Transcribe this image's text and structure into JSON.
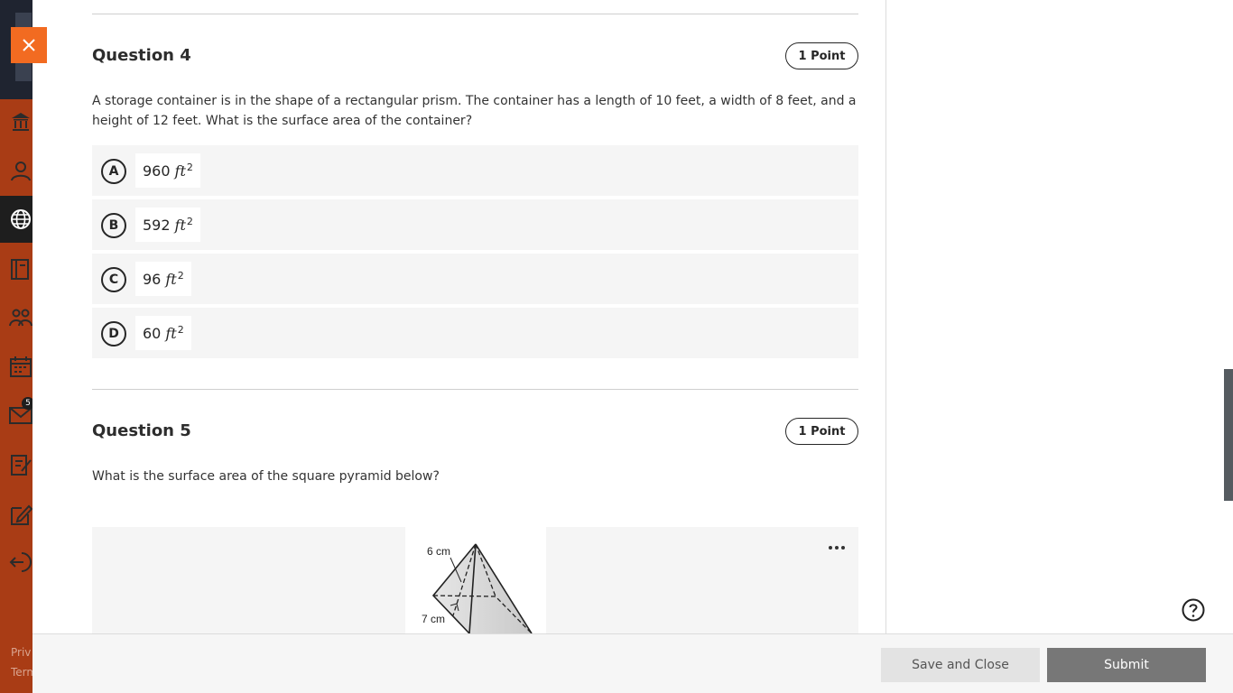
{
  "close_label": "×",
  "nav": {
    "badge_count": "5",
    "footer_links": [
      "Priv",
      "Term"
    ],
    "icons": [
      "institution-icon",
      "profile-icon",
      "globe-icon",
      "courses-icon",
      "groups-icon",
      "calendar-icon",
      "messages-icon",
      "grades-icon",
      "tools-icon",
      "sign-out-icon"
    ]
  },
  "questions": [
    {
      "title": "Question 4",
      "points": "1 Point",
      "text": "A storage container is in the shape of a rectangular prism. The container has a length of 10 feet, a width of 8 feet, and a height of 12 feet. What is the surface area of the container?",
      "choices": [
        {
          "letter": "A",
          "value": "960",
          "unit": "ft",
          "exp": "2"
        },
        {
          "letter": "B",
          "value": "592",
          "unit": "ft",
          "exp": "2"
        },
        {
          "letter": "C",
          "value": "96",
          "unit": "ft",
          "exp": "2"
        },
        {
          "letter": "D",
          "value": "60",
          "unit": "ft",
          "exp": "2"
        }
      ]
    },
    {
      "title": "Question 5",
      "points": "1 Point",
      "text": "What is the surface area of the square pyramid below?",
      "figure": {
        "label_height": "6 cm",
        "label_base": "7 cm"
      }
    }
  ],
  "footer": {
    "save_label": "Save and Close",
    "submit_label": "Submit"
  },
  "colors": {
    "rail": "#a93c15",
    "accent": "#f26b21",
    "submit": "#777777"
  }
}
